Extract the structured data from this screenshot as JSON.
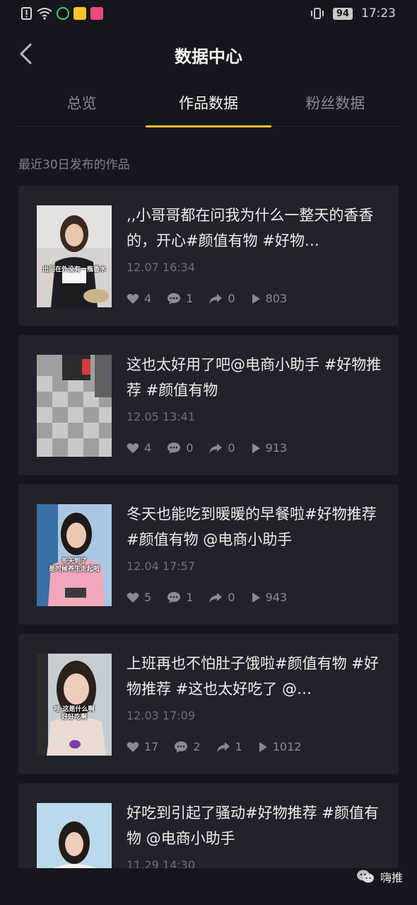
{
  "status": {
    "time": "17:23",
    "battery": "94"
  },
  "header": {
    "title": "数据中心"
  },
  "tabs": [
    {
      "label": "总览"
    },
    {
      "label": "作品数据"
    },
    {
      "label": "粉丝数据"
    }
  ],
  "active_tab": "作品数据",
  "section_label": "最近30日发布的作品",
  "posts": [
    {
      "caption": ",,小哥哥都在问我为什么一整天的香香的，开心#颜值有物 #好物…",
      "thumb_caption": "出门在外没有一瓶香水",
      "date": "12.07 16:34",
      "likes": "4",
      "comments": "1",
      "shares": "0",
      "plays": "803"
    },
    {
      "caption": "这也太好用了吧@电商小助手 #好物推荐 #颜值有物",
      "thumb_caption": "",
      "date": "12.05 13:41",
      "likes": "4",
      "comments": "0",
      "shares": "0",
      "plays": "913"
    },
    {
      "caption": "冬天也能吃到暖暖的早餐啦#好物推荐 #颜值有物 @电商小助手",
      "thumb_caption": "冬天到了\n是时候养生走起啦",
      "date": "12.04 17:57",
      "likes": "5",
      "comments": "1",
      "shares": "0",
      "plays": "943"
    },
    {
      "caption": "上班再也不怕肚子饿啦#颜值有物 #好物推荐 #这也太好吃了 @…",
      "thumb_caption": "哇 这是什么啊\n好好吃啊",
      "date": "12.03 17:09",
      "likes": "17",
      "comments": "2",
      "shares": "1",
      "plays": "1012"
    },
    {
      "caption": "好吃到引起了骚动#好物推荐 #颜值有物 @电商小助手",
      "thumb_caption": "",
      "date": "11.29 14:30",
      "likes": "",
      "comments": "",
      "shares": "",
      "plays": ""
    }
  ],
  "watermark": "嗨推",
  "colors": {
    "accent": "#f6c12b",
    "background": "#16161e",
    "card": "#22222b"
  },
  "icons": [
    "heart-icon",
    "comment-icon",
    "share-icon",
    "play-icon",
    "back-arrow-icon"
  ]
}
